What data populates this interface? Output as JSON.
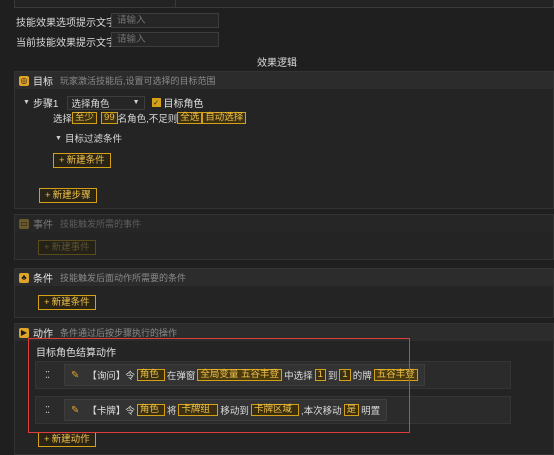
{
  "form": {
    "hint_label": "技能效果选项提示文字",
    "hint_placeholder": "请输入",
    "current_label": "当前技能效果提示文字",
    "current_placeholder": "请输入"
  },
  "logic_title": "效果逻辑",
  "target_section": {
    "title": "目标",
    "subtitle": "玩家激活技能后,设置可选择的目标范围",
    "step_label": "步骤1",
    "select_value": "选择角色",
    "checkbox_label": "目标角色",
    "select_prefix": "选择",
    "token_at_least": "至少",
    "token_count": "99",
    "count_suffix": "名角色,不足则",
    "token_select_all": "全选",
    "token_auto": "自动选择",
    "filter_label": "目标过滤条件",
    "new_condition": "新建条件",
    "new_step": "新建步骤"
  },
  "event_section": {
    "title": "事件",
    "subtitle": "技能触发所需的事件",
    "new_event": "新建事件"
  },
  "condition_section": {
    "title": "条件",
    "subtitle": "技能触发后面动作所需要的条件",
    "new_condition": "新建条件"
  },
  "action_section": {
    "title": "动作",
    "subtitle": "条件通过后按步骤执行的操作",
    "group_title": "目标角色结算动作",
    "action1": {
      "tag": "【询问】令",
      "tok_role": "角色",
      "t1": "在弹窗",
      "tok_var": "全局变量 五谷丰登",
      "t2": "中选择",
      "tok_n1": "1",
      "t3": "到",
      "tok_n2": "1",
      "t4": "的牌",
      "tok_name": "五谷丰登"
    },
    "action2": {
      "tag": "【卡牌】令",
      "tok_role": "角色",
      "t1": "将",
      "tok_group": "卡牌组",
      "t2": "移动到",
      "tok_area": "卡牌区域",
      "t3": ",本次移动",
      "tok_yes": "是",
      "t4": "明置"
    },
    "new_action": "新建动作"
  },
  "colors": {
    "accent": "#d4a017",
    "highlight_border": "#e23b3b",
    "background": "#1f1f1f"
  }
}
